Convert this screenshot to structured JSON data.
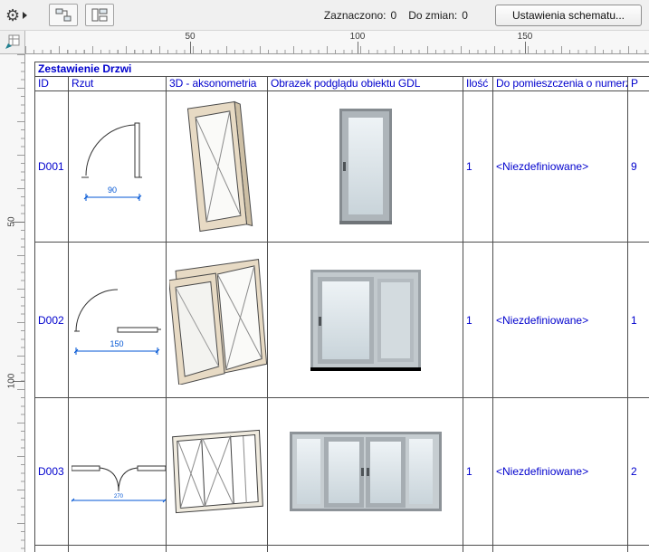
{
  "toolbar": {
    "selected_label": "Zaznaczono:",
    "selected_count": "0",
    "pending_label": "Do zmian:",
    "pending_count": "0",
    "settings_button": "Ustawienia schematu..."
  },
  "icons": {
    "gear_glyph": "⚙"
  },
  "rulers": {
    "horizontal": [
      "50",
      "100",
      "150"
    ],
    "vertical": [
      "50",
      "100"
    ]
  },
  "schedule": {
    "title": "Zestawienie Drzwi",
    "columns": [
      "ID",
      "Rzut",
      "3D - aksonometria",
      "Obrazek podglądu obiektu GDL",
      "Ilość",
      "Do pomieszczenia o numerze",
      "P"
    ],
    "rows": [
      {
        "id": "D001",
        "dim": "90",
        "qty": "1",
        "room": "<Niezdefiniowane>",
        "last": "9"
      },
      {
        "id": "D002",
        "dim": "150",
        "qty": "1",
        "room": "<Niezdefiniowane>",
        "last": "1"
      },
      {
        "id": "D003",
        "dim": "270",
        "qty": "1",
        "room": "<Niezdefiniowane>",
        "last": "2"
      }
    ]
  },
  "colors": {
    "table_text": "#0000CD",
    "dimension_blue": "#0055D4",
    "frame_beige": "#E7DAC4",
    "glass_gray": "#DDE4E8",
    "grid_line": "#4D4D4D"
  }
}
